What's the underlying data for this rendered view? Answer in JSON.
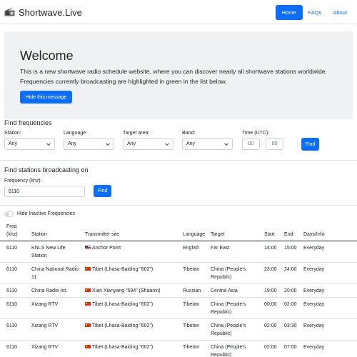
{
  "navbar": {
    "brand": "Shortwave.Live",
    "links": [
      "Home",
      "FAQs",
      "About"
    ]
  },
  "welcome": {
    "title": "Welcome",
    "text": "This is a new shortwave radio schedule website, where you can discover nearly all shortwave stations worldwide. Frequencies currently broadcasting are highlighted in green in the list below.",
    "hide_button": "Hide this message"
  },
  "find_frequencies": {
    "title": "Find frequencies",
    "station": {
      "label": "Station:",
      "value": "Any"
    },
    "language": {
      "label": "Language:",
      "value": "Any"
    },
    "target_area": {
      "label": "Target area:",
      "value": "Any"
    },
    "band": {
      "label": "Band:",
      "value": "Any"
    },
    "time": {
      "label": "Time (UTC):",
      "hour_placeholder": "00",
      "minute_placeholder": "00"
    },
    "find_button": "Find"
  },
  "find_stations": {
    "title": "Find stations broadcasting on",
    "frequency_label": "Frequency (khz):",
    "frequency_value": "6110",
    "find_button": "Find"
  },
  "toggle": {
    "label": "Hide Inactive Frequencies",
    "on": false
  },
  "table": {
    "headers": {
      "freq": [
        "Freq",
        "(khz)"
      ],
      "station": "Station",
      "site": "Transmitter site",
      "language": "Language",
      "target": "Target",
      "start": "Start",
      "end": "End",
      "days": "Days/Info"
    },
    "rows": [
      {
        "freq": "6110",
        "station": [
          "KNLS New Life",
          "Station"
        ],
        "flag": "us-flag-icon",
        "site": "Anchor Point",
        "language": "English",
        "target": [
          "Far East"
        ],
        "start": "14:00",
        "end": "15:00",
        "days": "Everyday"
      },
      {
        "freq": "6110",
        "station": [
          "China National Radio",
          "11"
        ],
        "flag": "cn-flag-icon",
        "site": "Tibet (Lhasa-Baiding \"602\")",
        "language": "Tibetan",
        "target": [
          "China (People's",
          "Republic)"
        ],
        "start": "23:00",
        "end": "24:00",
        "days": "Everyday"
      },
      {
        "freq": "6110",
        "station": [
          "China Radio Int."
        ],
        "flag": "cn-flag-icon",
        "site": "Xian Xianyang \"594\" (Shaanxi)",
        "language": "Russian",
        "target": [
          "Central Asia"
        ],
        "start": "19:00",
        "end": "20:00",
        "days": "Everyday"
      },
      {
        "freq": "6110",
        "station": [
          "Xizang RTV"
        ],
        "flag": "cn-flag-icon",
        "site": "Tibet (Lhasa-Baiding \"602\")",
        "language": "Tibetan",
        "target": [
          "China (People's",
          "Republic)"
        ],
        "start": "00:00",
        "end": "02:00",
        "days": "Everyday"
      },
      {
        "freq": "6110",
        "station": [
          "Xizang RTV"
        ],
        "flag": "cn-flag-icon",
        "site": "Tibet (Lhasa-Baiding \"602\")",
        "language": "Tibetan",
        "target": [
          "China (People's",
          "Republic)"
        ],
        "start": "02:00",
        "end": "03:30",
        "days": "Everyday"
      },
      {
        "freq": "6110",
        "station": [
          "Xizang RTV"
        ],
        "flag": "cn-flag-icon",
        "site": "Tibet (Lhasa-Baiding \"602\")",
        "language": "Tibetan",
        "target": [
          "China (People's",
          "Republic)"
        ],
        "start": "02:00",
        "end": "07:00",
        "days": "Everyday"
      }
    ]
  }
}
